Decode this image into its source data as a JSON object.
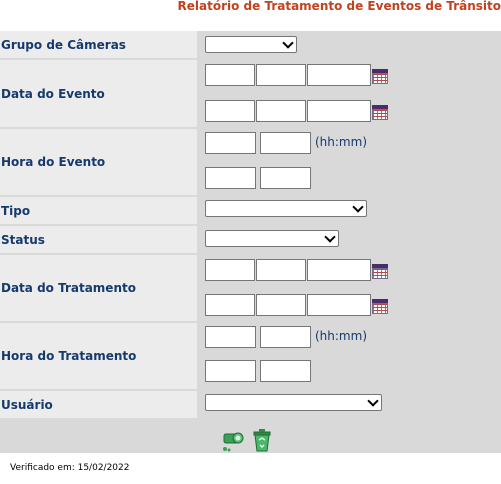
{
  "title": "Relatório de Tratamento de Eventos de Trânsito",
  "labels": {
    "grupo": "Grupo de Câmeras",
    "data_evento": "Data do Evento",
    "hora_evento": "Hora do Evento",
    "tipo": "Tipo",
    "status": "Status",
    "data_tratamento": "Data do Tratamento",
    "hora_tratamento": "Hora do Tratamento",
    "usuario": "Usuário"
  },
  "hint_time": "(hh:mm)",
  "footer": "Verificado em: 15/02/2022",
  "icons": {
    "search": "search-camera-icon",
    "clear": "recycle-bin-icon",
    "calendar": "calendar-icon"
  }
}
